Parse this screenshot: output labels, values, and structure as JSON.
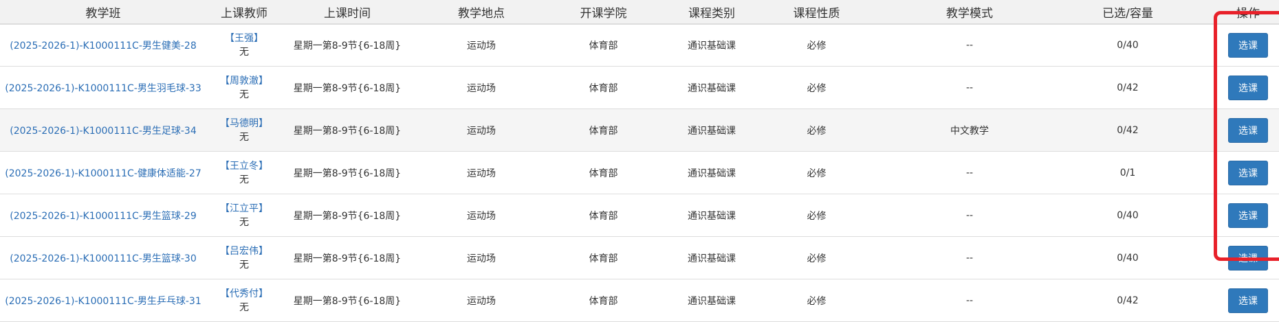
{
  "headers": [
    "教学班",
    "上课教师",
    "上课时间",
    "教学地点",
    "开课学院",
    "课程类别",
    "课程性质",
    "教学模式",
    "已选/容量",
    "操作"
  ],
  "rows": [
    {
      "class_name": "(2025-2026-1)-K1000111C-男生健美-28",
      "teacher": "【王强】",
      "teacher_title": "无",
      "time": "星期一第8-9节{6-18周}",
      "location": "运动场",
      "college": "体育部",
      "category": "通识基础课",
      "nature": "必修",
      "mode": "--",
      "enrolled": "0/40",
      "action": "选课"
    },
    {
      "class_name": "(2025-2026-1)-K1000111C-男生羽毛球-33",
      "teacher": "【周敦澈】",
      "teacher_title": "无",
      "time": "星期一第8-9节{6-18周}",
      "location": "运动场",
      "college": "体育部",
      "category": "通识基础课",
      "nature": "必修",
      "mode": "--",
      "enrolled": "0/42",
      "action": "选课"
    },
    {
      "class_name": "(2025-2026-1)-K1000111C-男生足球-34",
      "teacher": "【马德明】",
      "teacher_title": "无",
      "time": "星期一第8-9节{6-18周}",
      "location": "运动场",
      "college": "体育部",
      "category": "通识基础课",
      "nature": "必修",
      "mode": "中文教学",
      "enrolled": "0/42",
      "action": "选课"
    },
    {
      "class_name": "(2025-2026-1)-K1000111C-健康体适能-27",
      "teacher": "【王立冬】",
      "teacher_title": "无",
      "time": "星期一第8-9节{6-18周}",
      "location": "运动场",
      "college": "体育部",
      "category": "通识基础课",
      "nature": "必修",
      "mode": "--",
      "enrolled": "0/1",
      "action": "选课"
    },
    {
      "class_name": "(2025-2026-1)-K1000111C-男生篮球-29",
      "teacher": "【江立平】",
      "teacher_title": "无",
      "time": "星期一第8-9节{6-18周}",
      "location": "运动场",
      "college": "体育部",
      "category": "通识基础课",
      "nature": "必修",
      "mode": "--",
      "enrolled": "0/40",
      "action": "选课"
    },
    {
      "class_name": "(2025-2026-1)-K1000111C-男生篮球-30",
      "teacher": "【吕宏伟】",
      "teacher_title": "无",
      "time": "星期一第8-9节{6-18周}",
      "location": "运动场",
      "college": "体育部",
      "category": "通识基础课",
      "nature": "必修",
      "mode": "--",
      "enrolled": "0/40",
      "action": "选课"
    },
    {
      "class_name": "(2025-2026-1)-K1000111C-男生乒乓球-31",
      "teacher": "【代秀付】",
      "teacher_title": "无",
      "time": "星期一第8-9节{6-18周}",
      "location": "运动场",
      "college": "体育部",
      "category": "通识基础课",
      "nature": "必修",
      "mode": "--",
      "enrolled": "0/42",
      "action": "选课"
    }
  ],
  "colors": {
    "link": "#2a6db5",
    "button": "#2f79bb",
    "highlight": "#e8212a",
    "alt_row": "#f5f5f5"
  }
}
